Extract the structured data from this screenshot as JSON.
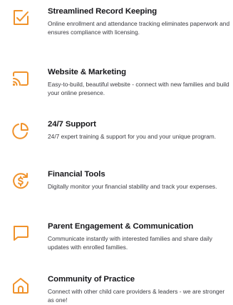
{
  "features": [
    {
      "icon": "checklist-edit-icon",
      "title": "Streamlined Record Keeping",
      "description": "Online enrollment and attendance tracking eliminates paperwork and ensures compliance with licensing."
    },
    {
      "icon": "screen-cast-icon",
      "title": "Website & Marketing",
      "description": "Easy-to-build, beautiful website - connect with new families and build your online presence."
    },
    {
      "icon": "pie-chart-icon",
      "title": "24/7 Support",
      "description": "24/7 expert training & support for you and your unique program."
    },
    {
      "icon": "dollar-cycle-icon",
      "title": "Financial Tools",
      "description": "Digitally monitor your financial stability and track your expenses."
    },
    {
      "icon": "chat-bubble-icon",
      "title": "Parent Engagement & Communication",
      "description": "Communicate instantly with interested families and share daily updates with enrolled families."
    },
    {
      "icon": "home-icon",
      "title": "Community of Practice",
      "description": "Connect with other child care providers & leaders - we are stronger as one!"
    }
  ],
  "colors": {
    "accent": "#f0922b",
    "title": "#16161a",
    "text": "#3a3a40",
    "background": "#ffffff"
  }
}
